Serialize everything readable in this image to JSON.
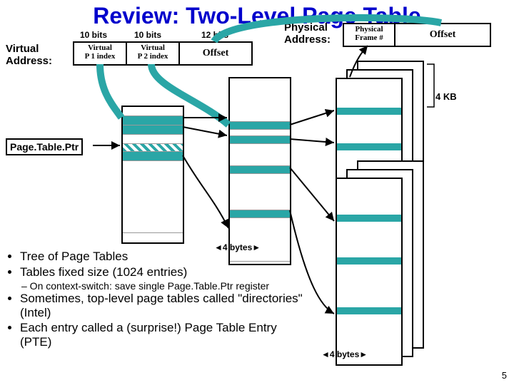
{
  "title": "Review: Two-Level Page Table",
  "virtual_addr_label": "Virtual\nAddress:",
  "phys_addr_label": "Physical\nAddress:",
  "va_fields": {
    "p1_bits": "10 bits",
    "p1_name": "Virtual\nP 1 index",
    "p2_bits": "10 bits",
    "p2_name": "Virtual\nP 2 index",
    "off_bits": "12 bits",
    "off_name": "Offset"
  },
  "pa_fields": {
    "frame": "Physical\nFrame #",
    "offset": "Offset"
  },
  "page_size": "4 KB",
  "ptptr": "Page.Table.Ptr",
  "entry_size1": "4 bytes",
  "entry_size2": "4 bytes",
  "bullets": {
    "b1": "Tree of Page Tables",
    "b2": "Tables fixed size (1024 entries)",
    "b2s": "– On context-switch: save single Page.Table.Ptr register",
    "b3": "Sometimes, top-level page tables called \"directories\" (Intel)",
    "b4": "Each entry called a (surprise!) Page Table Entry (PTE)"
  },
  "page_num": "5"
}
